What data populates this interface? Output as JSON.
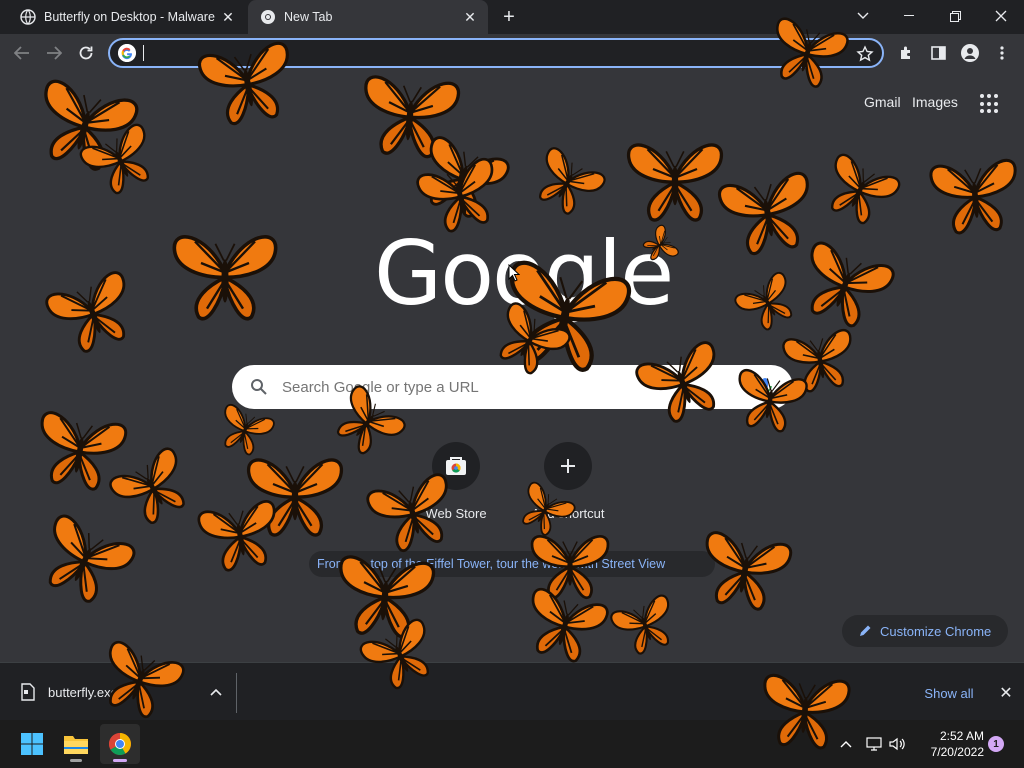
{
  "tabs": [
    {
      "title": "Butterfly on Desktop - Malware V",
      "favicon": "globe-icon",
      "active": false
    },
    {
      "title": "New Tab",
      "favicon": "chrome-icon",
      "active": true
    }
  ],
  "omnibox": {
    "value": "",
    "placeholder": ""
  },
  "ntp": {
    "gmail": "Gmail",
    "images": "Images",
    "logo": "Google",
    "search_placeholder": "Search Google or type a URL",
    "shortcuts": [
      {
        "label": "Web Store",
        "icon": "web-store-icon"
      },
      {
        "label": "Add shortcut",
        "icon": "plus-icon"
      }
    ],
    "promo_chip": "From the top of the Eiffel Tower, tour the world with Street View",
    "customize_label": "Customize Chrome"
  },
  "download_shelf": {
    "filename": "butterfly.exe",
    "show_all": "Show all"
  },
  "taskbar": {
    "time": "2:52 AM",
    "date": "7/20/2022",
    "notification_count": "1"
  },
  "colors": {
    "accent": "#8ab4f8",
    "butterfly": "#f07a10"
  }
}
